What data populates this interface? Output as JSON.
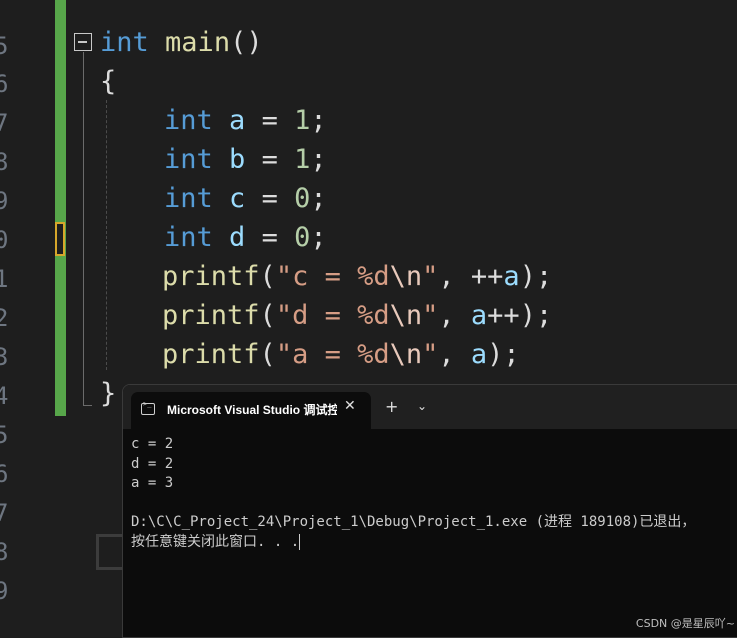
{
  "editor": {
    "line_numbers": [
      "5",
      "6",
      "7",
      "8",
      "9",
      "0",
      "1",
      "2",
      "3",
      "4",
      "5",
      "6",
      "7",
      "8",
      "9"
    ],
    "code": {
      "l1": {
        "kw": "int",
        "fn": "main",
        "rest": "()"
      },
      "l2": {
        "brace": "{"
      },
      "l3": {
        "kw": "int",
        "var": "a",
        "op": " = ",
        "num": "1",
        "end": ";"
      },
      "l4": {
        "kw": "int",
        "var": "b",
        "op": " = ",
        "num": "1",
        "end": ";"
      },
      "l5": {
        "kw": "int",
        "var": "c",
        "op": " = ",
        "num": "0",
        "end": ";"
      },
      "l6": {
        "kw": "int",
        "var": "d",
        "op": " = ",
        "num": "0",
        "end": ";"
      },
      "l7": {
        "fn": "printf",
        "open": "(",
        "str1": "\"c = %d",
        "esc": "\\n",
        "str2": "\"",
        ", ": ", ",
        "pre": "++",
        "var": "a",
        "close": ");"
      },
      "l8": {
        "fn": "printf",
        "open": "(",
        "str1": "\"d = %d",
        "esc": "\\n",
        "str2": "\"",
        "comma": ", ",
        "var": "a",
        "post": "++",
        "close": ");"
      },
      "l9": {
        "fn": "printf",
        "open": "(",
        "str1": "\"a = %d",
        "esc": "\\n",
        "str2": "\"",
        "comma": ", ",
        "var": "a",
        "close": ");"
      },
      "l10": {
        "brace": "}"
      }
    }
  },
  "terminal": {
    "tab_title": "Microsoft Visual Studio 调试控制台",
    "close_glyph": "✕",
    "new_tab_glyph": "+",
    "dropdown_glyph": "⌄",
    "lines": [
      "c = 2",
      "d = 2",
      "a = 3",
      "",
      "D:\\C\\C_Project_24\\Project_1\\Debug\\Project_1.exe (进程 189108)已退出，",
      "按任意键关闭此窗口. . ."
    ]
  },
  "watermark": "CSDN @是星辰吖~"
}
